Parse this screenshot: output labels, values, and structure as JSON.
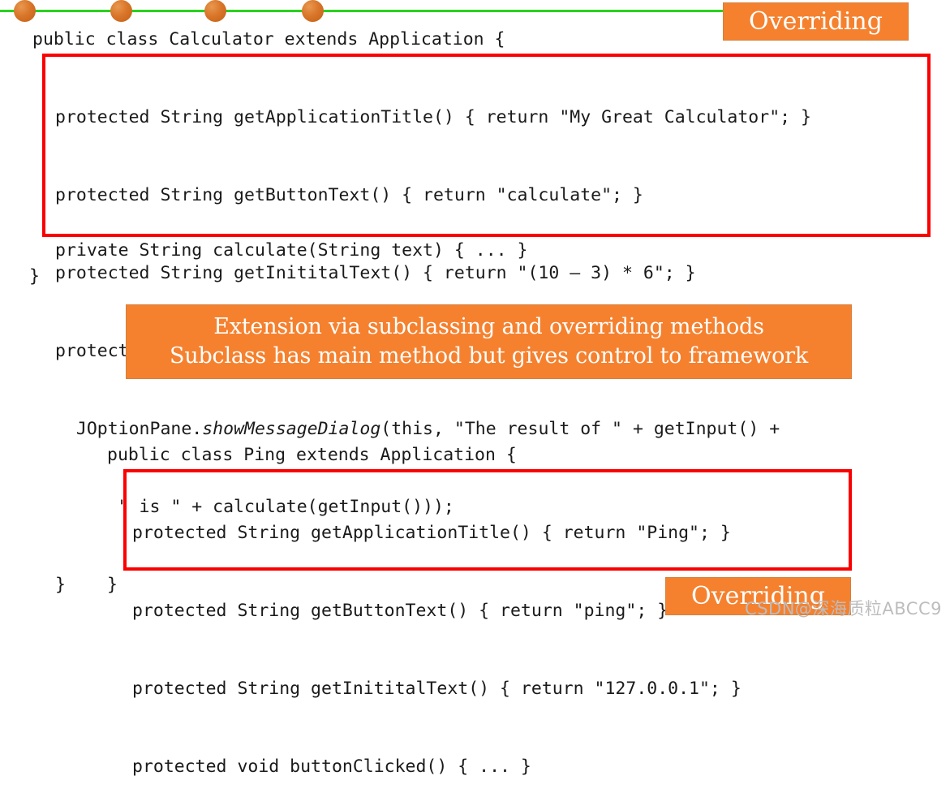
{
  "slide": {
    "decoration": {
      "line_color": "#2ad21e",
      "bead_color": "#d9762a",
      "bead_count": 4
    },
    "accent_colors": {
      "orange": "#f5812f",
      "red_outline": "#fa0000",
      "green_rule": "#2ad21e",
      "code_text": "#1a1a1a",
      "chip_text": "#ffffff"
    }
  },
  "labels": {
    "overriding_top": "Overriding",
    "overriding_bottom": "Overriding"
  },
  "callout": {
    "line1": "Extension via subclassing and overriding methods",
    "line2": "Subclass has main method but gives control to framework"
  },
  "calculator": {
    "header": "public class Calculator extends Application {",
    "overridden_methods": {
      "line1": "protected String getApplicationTitle() { return \"My Great Calculator\"; }",
      "line2": "protected String getButtonText() { return \"calculate\"; }",
      "line3": "protected String getInititalText() { return \"(10 – 3) * 6\"; }",
      "line4": "protected void buttonClicked() {",
      "line5_a": "  JOptionPane.",
      "line5_b": "showMessageDialog",
      "line5_c": "(this, \"The result of \" + getInput() +",
      "line6": "      \" is \" + calculate(getInput()));",
      "line7": "}"
    },
    "private_method": "private String calculate(String text) { ... }",
    "class_close": "}"
  },
  "ping": {
    "header": "public class Ping extends Application {",
    "overridden_methods": {
      "line1": "protected String getApplicationTitle() { return \"Ping\"; }",
      "line2": "protected String getButtonText() { return \"ping\"; }",
      "line3": "protected String getInititalText() { return \"127.0.0.1\"; }",
      "line4": "protected void buttonClicked() { ... }"
    },
    "class_close": "}"
  },
  "watermark": {
    "text": "CSDN@深海质粒ABCC9"
  }
}
